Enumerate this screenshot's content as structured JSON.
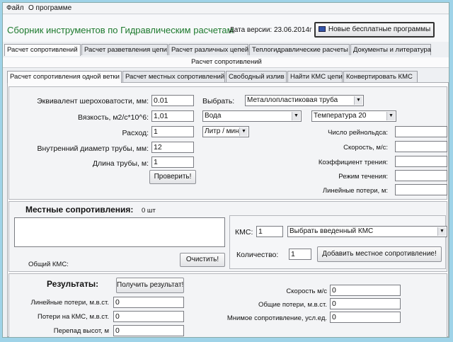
{
  "menu": {
    "file": "Файл",
    "about": "О программе"
  },
  "header": {
    "title": "Сборник инструментов по Гидравлическим расчетам",
    "version": "Дата версии: 23.06.2014г",
    "free_programs_button": "Новые бесплатные программы"
  },
  "main_tabs": [
    "Расчет сопротивлений",
    "Расчет разветвления цепи",
    "Расчет различных цепей",
    "Теплогидравлические расчеты",
    "Документы и литература"
  ],
  "section_title": "Расчет сопротивлений",
  "sub_tabs": [
    "Расчет сопротивления одной ветки",
    "Расчет местных сопротивлений",
    "Свободный излив",
    "Найти КМС цепи",
    "Конвертировать КМС"
  ],
  "form": {
    "roughness_label": "Эквивалент шероховатости, мм:",
    "roughness_value": "0.01",
    "viscosity_label": "Вязкость, м2/с*10^6:",
    "viscosity_value": "1,01",
    "flow_label": "Расход:",
    "flow_value": "1",
    "diameter_label": "Внутренний диаметр трубы, мм:",
    "diameter_value": "12",
    "length_label": "Длина трубы, м:",
    "length_value": "1",
    "check_button": "Проверить!",
    "choose_label": "Выбрать:",
    "pipe_type": "Металлопластиковая труба",
    "fluid": "Вода",
    "temperature": "Температура 20",
    "flow_unit": "Литр / мин"
  },
  "results_right": {
    "reynolds_label": "Число рейнольдса:",
    "speed_label": "Скорость, м/с:",
    "friction_label": "Коэффициент трения:",
    "mode_label": "Режим течения:",
    "linear_loss_label": "Линейные потери, м:"
  },
  "local": {
    "title": "Местные сопротивления:",
    "count": "0 шт",
    "total_kms_label": "Общий КМС:",
    "clear_button": "Очистить!",
    "kms_label": "КМС:",
    "kms_value": "1",
    "kms_select": "Выбрать введенный КМС",
    "quantity_label": "Количество:",
    "quantity_value": "1",
    "add_button": "Добавить местное сопротивление!"
  },
  "results": {
    "title": "Результаты:",
    "get_button": "Получить результат!",
    "linear_losses_label": "Линейные потери, м.в.ст.",
    "linear_losses_value": "0",
    "kms_losses_label": "Потери на КМС, м.в.ст.",
    "kms_losses_value": "0",
    "height_diff_label": "Перепад высот, м",
    "height_diff_value": "0",
    "speed_label": "Скорость м/с",
    "speed_value": "0",
    "total_losses_label": "Общие потери, м.в.ст.",
    "total_losses_value": "0",
    "imaginary_label": "Мнимое сопротивление, усл.ед.",
    "imaginary_value": "0"
  }
}
